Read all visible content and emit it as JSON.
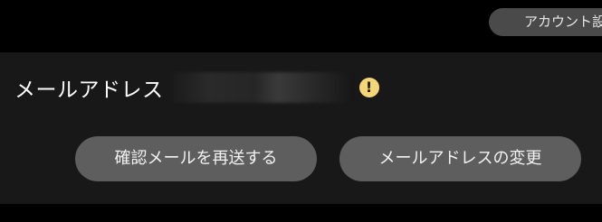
{
  "header": {
    "account_button_label": "アカウント設定"
  },
  "email_section": {
    "label": "メールアドレス",
    "value": "",
    "warning_icon": "exclamation-icon",
    "warning_icon_glyph": "!",
    "resend_button_label": "確認メールを再送する",
    "change_button_label": "メールアドレスの変更"
  },
  "colors": {
    "background": "#000000",
    "panel": "#181818",
    "button": "#5e5e5e",
    "warning": "#f5d677"
  }
}
